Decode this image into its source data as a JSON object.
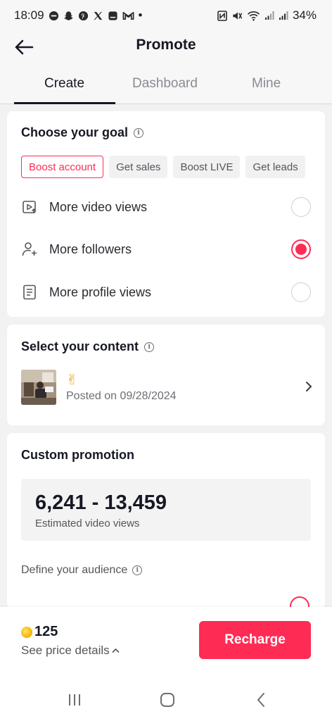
{
  "status_bar": {
    "time": "18:09",
    "dot": "•",
    "battery": "34%",
    "left_icons": [
      "minus-circle-icon",
      "snapchat-icon",
      "pinterest-icon",
      "x-icon",
      "messenger-icon",
      "gmail-icon"
    ],
    "right_icons": [
      "nfc-icon",
      "mute-icon",
      "wifi-icon",
      "signal-icon",
      "signal-icon"
    ]
  },
  "header": {
    "title": "Promote"
  },
  "tabs": [
    {
      "label": "Create",
      "active": true
    },
    {
      "label": "Dashboard",
      "active": false
    },
    {
      "label": "Mine",
      "active": false
    }
  ],
  "goal": {
    "title": "Choose your goal",
    "chips": [
      "Boost account",
      "Get sales",
      "Boost LIVE",
      "Get leads"
    ],
    "selected_chip": "Boost account",
    "options": [
      {
        "label": "More video views",
        "icon": "video-views-icon",
        "selected": false
      },
      {
        "label": "More followers",
        "icon": "add-follower-icon",
        "selected": true
      },
      {
        "label": "More profile views",
        "icon": "profile-doc-icon",
        "selected": false
      }
    ]
  },
  "content": {
    "title": "Select your content",
    "emoji": "✌",
    "posted": "Posted on 09/28/2024"
  },
  "promotion": {
    "title": "Custom promotion",
    "estimate_range": "6,241 - 13,459",
    "estimate_label": "Estimated video views",
    "audience_label": "Define your audience"
  },
  "bottom": {
    "coins": "125",
    "price_details": "See price details",
    "recharge": "Recharge"
  },
  "colors": {
    "accent": "#fe2c55",
    "text": "#161823",
    "muted": "#8a8b91",
    "background": "#f2f2f3"
  }
}
